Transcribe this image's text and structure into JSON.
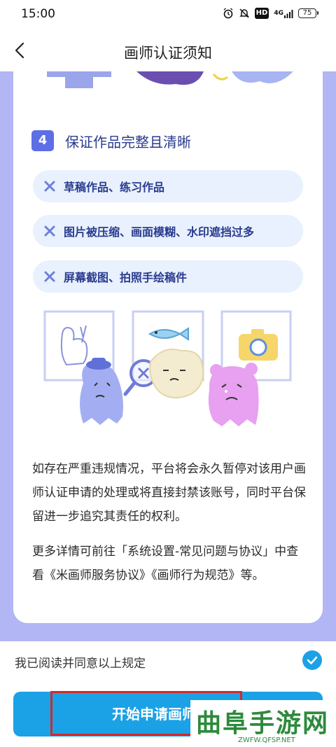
{
  "status_bar": {
    "time": "15:00",
    "icons": [
      "alarm-icon",
      "mute-icon",
      "hd-icon",
      "signal-4g-icon"
    ],
    "hd": "HD",
    "network": "4G",
    "battery": "75"
  },
  "header": {
    "title": "画师认证须知",
    "back_icon": "chevron-left-icon"
  },
  "section": {
    "number": "4",
    "title": "保证作品完整且清晰",
    "rules": [
      {
        "icon": "cross-icon",
        "text": "草稿作品、练习作品"
      },
      {
        "icon": "cross-icon",
        "text": "图片被压缩、画面模糊、水印遮挡过多"
      },
      {
        "icon": "cross-icon",
        "text": "屏幕截图、拍照手绘稿件"
      }
    ]
  },
  "notice": {
    "paragraph_1": "如存在严重违规情况，平台将会永久暂停对该用户画师认证申请的处理或将直接封禁该账号，同时平台保留进一步追究其责任的权利。",
    "paragraph_2": "更多详情可前往「系统设置-常见问题与协议」中查看《米画师服务协议》《画师行为规范》等。"
  },
  "agreement": {
    "label": "我已阅读并同意以上规定",
    "checked": true
  },
  "apply_button": {
    "label": "开始申请画师认证"
  },
  "watermark": {
    "text": "曲阜手游网",
    "url": "ZWFW.QFSP.NET"
  },
  "colors": {
    "accent": "#1ba1e6",
    "section_badge": "#5d6ee6",
    "purple_bg": "#b2b6f4",
    "pill_bg": "#e8f1fd",
    "highlight_box": "#d22b2b"
  }
}
